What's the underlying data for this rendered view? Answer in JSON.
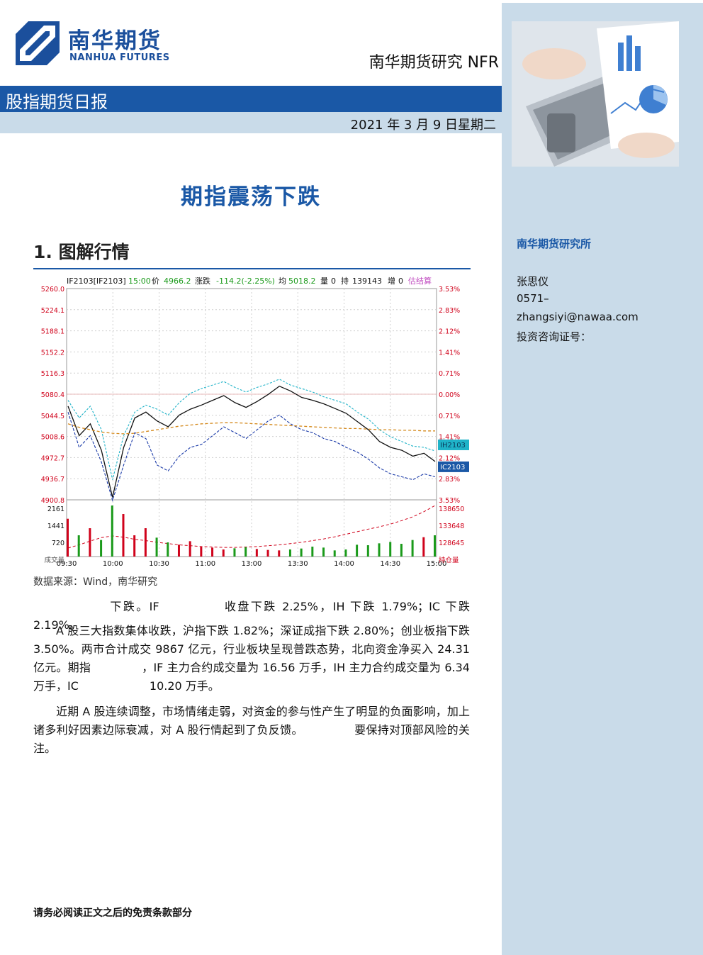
{
  "header": {
    "logo_cn": "南华期货",
    "logo_en": "NANHUA FUTURES",
    "research_title": "南华期货研究  NFR",
    "report_type": "股指期货日报",
    "date": "2021 年 3 月 9 日星期二"
  },
  "headline": "期指震荡下跌",
  "section": {
    "heading": "1. 图解行情"
  },
  "colors": {
    "brand_blue": "#1a58a6",
    "sidebar_bg": "#c9dbe9",
    "up_red": "#d0021b",
    "down_green": "#1a9a1a"
  },
  "chart_data": {
    "type": "line",
    "info_bar": {
      "code": "IF2103[IF2103]",
      "time": "15:00",
      "price_label": "价",
      "price": "4966.2",
      "change_label": "涨跌",
      "change": "-114.2(-2.25%)",
      "avg_label": "均",
      "avg": "5018.2",
      "vol_label": "量",
      "vol": "0",
      "oi_label": "持",
      "oi": "139143",
      "oi_chg_label": "增",
      "oi_chg": "0",
      "mode": "估结算"
    },
    "y_left_ticks": [
      "5260.0",
      "5224.1",
      "5188.1",
      "5152.2",
      "5116.3",
      "5080.4",
      "5044.5",
      "5008.6",
      "4972.7",
      "4936.7",
      "4900.8"
    ],
    "y_right_ticks": [
      "3.53%",
      "2.83%",
      "2.12%",
      "1.41%",
      "0.71%",
      "0.00%",
      "0.71%",
      "1.41%",
      "2.12%",
      "2.83%",
      "3.53%"
    ],
    "vol_left_ticks": [
      "2161",
      "1441",
      "720",
      "成交量"
    ],
    "vol_right_ticks": [
      "138650",
      "133648",
      "128645",
      "持仓量"
    ],
    "x_ticks": [
      "09:30",
      "10:00",
      "10:30",
      "11:00",
      "13:00",
      "13:30",
      "14:00",
      "14:30",
      "15:00"
    ],
    "ylim": [
      4900.8,
      5260.0
    ],
    "prev_close": 5080.4,
    "series_tags": [
      "IH2103",
      "IC2103"
    ],
    "series": [
      {
        "name": "IF2103",
        "values": [
          5060,
          5010,
          5030,
          4985,
          4905,
          4990,
          5040,
          5050,
          5035,
          5025,
          5045,
          5055,
          5062,
          5070,
          5078,
          5066,
          5058,
          5068,
          5080,
          5094,
          5086,
          5075,
          5070,
          5064,
          5056,
          5048,
          5034,
          5020,
          5000,
          4990,
          4985,
          4975,
          4980,
          4966
        ]
      },
      {
        "name": "IH2103",
        "values": [
          5070,
          5040,
          5060,
          5020,
          4935,
          5010,
          5050,
          5062,
          5055,
          5045,
          5066,
          5082,
          5090,
          5096,
          5102,
          5092,
          5084,
          5092,
          5098,
          5106,
          5096,
          5090,
          5084,
          5076,
          5070,
          5064,
          5050,
          5038,
          5020,
          5008,
          5000,
          4992,
          4990,
          4984
        ]
      },
      {
        "name": "IC2103",
        "values": [
          5050,
          4990,
          5010,
          4965,
          4900,
          4960,
          5015,
          5005,
          4960,
          4950,
          4975,
          4990,
          4995,
          5010,
          5025,
          5015,
          5005,
          5020,
          5035,
          5045,
          5030,
          5020,
          5015,
          5005,
          5000,
          4990,
          4982,
          4970,
          4955,
          4945,
          4940,
          4935,
          4945,
          4940
        ]
      },
      {
        "name": "均",
        "values": [
          5030,
          5024,
          5020,
          5016,
          5014,
          5013,
          5014,
          5017,
          5020,
          5023,
          5026,
          5028,
          5030,
          5031,
          5032,
          5032,
          5031,
          5030,
          5029,
          5028,
          5027,
          5026,
          5025,
          5024,
          5023,
          5022,
          5022,
          5021,
          5020,
          5020,
          5019,
          5019,
          5018,
          5018
        ]
      }
    ],
    "volume": [
      1600,
      900,
      1200,
      700,
      2161,
      1800,
      900,
      1200,
      800,
      600,
      500,
      650,
      420,
      380,
      300,
      350,
      400,
      320,
      280,
      260,
      300,
      340,
      420,
      380,
      260,
      300,
      500,
      480,
      560,
      620,
      540,
      700,
      820,
      900
    ],
    "open_interest": [
      128645,
      129400,
      130300,
      131100,
      131500,
      131200,
      130700,
      130400,
      130000,
      129700,
      129400,
      129200,
      129000,
      128900,
      128800,
      128800,
      128900,
      129000,
      129200,
      129400,
      129700,
      130000,
      130400,
      130800,
      131300,
      131900,
      132500,
      133100,
      133648,
      134300,
      135100,
      136000,
      137200,
      138650
    ]
  },
  "source": "数据来源：Wind，南华研究",
  "paragraphs": {
    "p0_a": "下跌。IF",
    "p0_b": "收盘下跌 2.25%，IH 下跌 1.79%；IC 下跌 2.19%。",
    "p1_a": "A 股三大指数集体收跌，沪指下跌 1.82%；深证成指下跌 2.80%；创业板指下跌 3.50%。两市合计成交 9867 亿元，行业板块呈现普跌态势，北向资金净买入 24.31 亿元。期指",
    "p1_b": "，IF 主力合约成交量为 16.56 万手，IH 主力合约成交量为 6.34 万手，IC",
    "p1_c": "10.20 万手。",
    "p2_a": "近期 A 股连续调整，市场情绪走弱，对资金的参与性产生了明显的负面影响，加上诸多利好因素边际衰减，对 A 股行情起到了负反馈。",
    "p2_b": "要保持对顶部风险的关注。"
  },
  "sidebar": {
    "institute": "南华期货研究所",
    "analyst": "张思仪",
    "phone": "0571–",
    "email": "zhangsiyi@nawaa.com",
    "license_label": "投资咨询证号："
  },
  "footer": {
    "disclaimer": "请务必阅读正文之后的免责条款部分"
  }
}
